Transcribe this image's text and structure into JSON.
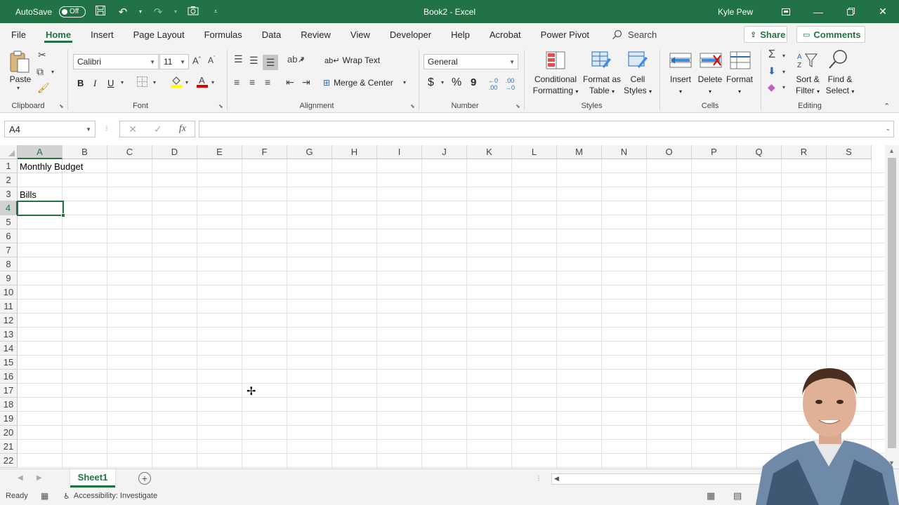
{
  "titlebar": {
    "autosave_label": "AutoSave",
    "autosave_state": "Off",
    "title": "Book2 - Excel",
    "user": "Kyle Pew",
    "color": "#217346"
  },
  "menu": {
    "tabs": [
      "File",
      "Home",
      "Insert",
      "Page Layout",
      "Formulas",
      "Data",
      "Review",
      "View",
      "Developer",
      "Help",
      "Acrobat",
      "Power Pivot"
    ],
    "active_tab": "Home",
    "search": "Search",
    "share": "Share",
    "comments": "Comments"
  },
  "ribbon": {
    "clipboard": {
      "paste": "Paste",
      "label": "Clipboard"
    },
    "font": {
      "name": "Calibri",
      "size": "11",
      "bold": "B",
      "italic": "I",
      "underline": "U",
      "label": "Font"
    },
    "alignment": {
      "wrap_text": "Wrap Text",
      "merge_center": "Merge & Center",
      "label": "Alignment"
    },
    "number": {
      "format": "General",
      "currency": "$",
      "percent": "%",
      "comma": "9",
      "label": "Number"
    },
    "styles": {
      "conditional_1": "Conditional",
      "conditional_2": "Formatting",
      "format_table_1": "Format as",
      "format_table_2": "Table",
      "cell_styles_1": "Cell",
      "cell_styles_2": "Styles",
      "label": "Styles"
    },
    "cells": {
      "insert": "Insert",
      "delete": "Delete",
      "format": "Format",
      "label": "Cells"
    },
    "editing": {
      "sort_1": "Sort &",
      "sort_2": "Filter",
      "find_1": "Find &",
      "find_2": "Select",
      "label": "Editing"
    }
  },
  "formula_bar": {
    "name_box": "A4",
    "formula": ""
  },
  "grid": {
    "columns": [
      "A",
      "B",
      "C",
      "D",
      "E",
      "F",
      "G",
      "H",
      "I",
      "J",
      "K",
      "L",
      "M",
      "N",
      "O",
      "P",
      "Q",
      "R",
      "S"
    ],
    "rows": [
      "1",
      "2",
      "3",
      "4",
      "5",
      "6",
      "7",
      "8",
      "9",
      "10",
      "11",
      "12",
      "13",
      "14",
      "15",
      "16",
      "17",
      "18",
      "19",
      "20",
      "21",
      "22"
    ],
    "selected_column": "A",
    "selected_row": "4",
    "cells": {
      "A1": "Monthly Budget",
      "A3": "Bills"
    }
  },
  "sheets": {
    "tabs": [
      "Sheet1"
    ],
    "active": "Sheet1"
  },
  "status": {
    "ready": "Ready",
    "accessibility": "Accessibility: Investigate"
  }
}
